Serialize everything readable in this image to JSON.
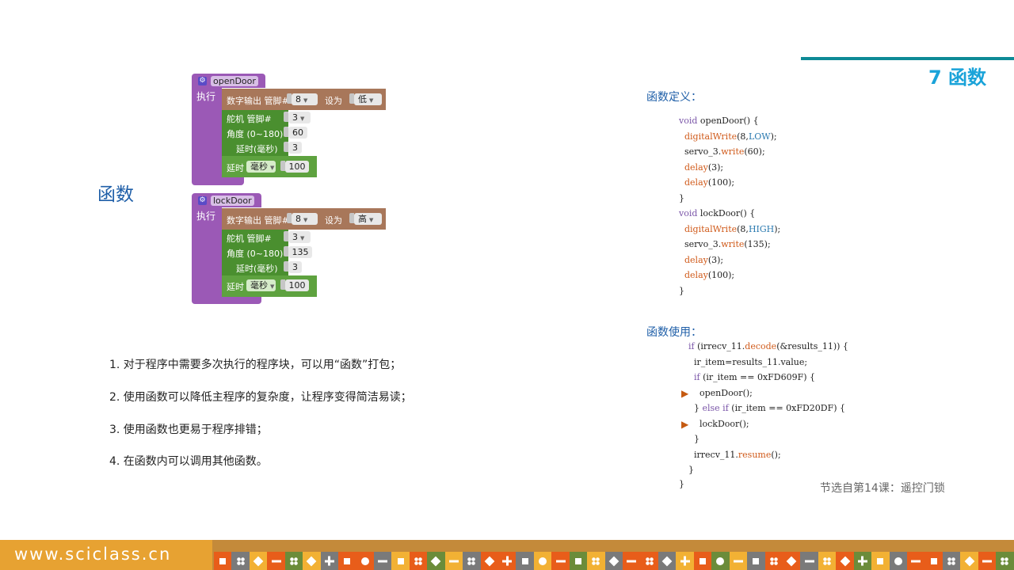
{
  "header": {
    "chapter_title": "7 函数"
  },
  "side_heading": "函数",
  "blocks": [
    {
      "name": "openDoor",
      "exec_label": "执行",
      "digital_out_label": "数字输出 管脚#",
      "pin_value": "8",
      "set_label": "设为",
      "level_value": "低",
      "servo_label": "舵机 管脚#",
      "servo_pin": "3",
      "angle_label": "角度 (0~180)",
      "angle_value": "60",
      "servo_delay_label": "延时(毫秒)",
      "servo_delay_value": "3",
      "delay_label": "延时",
      "delay_unit": "毫秒",
      "delay_value": "100"
    },
    {
      "name": "lockDoor",
      "exec_label": "执行",
      "digital_out_label": "数字输出 管脚#",
      "pin_value": "8",
      "set_label": "设为",
      "level_value": "高",
      "servo_label": "舵机 管脚#",
      "servo_pin": "3",
      "angle_label": "角度 (0~180)",
      "angle_value": "135",
      "servo_delay_label": "延时(毫秒)",
      "servo_delay_value": "3",
      "delay_label": "延时",
      "delay_unit": "毫秒",
      "delay_value": "100"
    }
  ],
  "notes": [
    "1. 对于程序中需要多次执行的程序块，可以用“函数”打包；",
    "2. 使用函数可以降低主程序的复杂度，让程序变得简洁易读；",
    "3. 使用函数也更易于程序排错；",
    "4. 在函数内可以调用其他函数。"
  ],
  "definition": {
    "label": "函数定义：",
    "lines": [
      {
        "segments": [
          [
            "kw",
            "void"
          ],
          [
            "",
            " openDoor() {"
          ]
        ]
      },
      {
        "segments": [
          [
            "fn",
            "  digitalWrite"
          ],
          [
            "",
            "(8,"
          ],
          [
            "cn",
            "LOW"
          ],
          [
            "",
            ");"
          ]
        ]
      },
      {
        "segments": [
          [
            "",
            "  servo_3."
          ],
          [
            "fn",
            "write"
          ],
          [
            "",
            "(60);"
          ]
        ]
      },
      {
        "segments": [
          [
            "fn",
            "  delay"
          ],
          [
            "",
            "(3);"
          ]
        ]
      },
      {
        "segments": [
          [
            "fn",
            "  delay"
          ],
          [
            "",
            "(100);"
          ]
        ]
      },
      {
        "segments": [
          [
            "",
            "}"
          ]
        ]
      },
      {
        "segments": [
          [
            "kw",
            "void"
          ],
          [
            "",
            " lockDoor() {"
          ]
        ]
      },
      {
        "segments": [
          [
            "fn",
            "  digitalWrite"
          ],
          [
            "",
            "(8,"
          ],
          [
            "cn",
            "HIGH"
          ],
          [
            "",
            ");"
          ]
        ]
      },
      {
        "segments": [
          [
            "",
            "  servo_3."
          ],
          [
            "fn",
            "write"
          ],
          [
            "",
            "(135);"
          ]
        ]
      },
      {
        "segments": [
          [
            "fn",
            "  delay"
          ],
          [
            "",
            "(3);"
          ]
        ]
      },
      {
        "segments": [
          [
            "fn",
            "  delay"
          ],
          [
            "",
            "(100);"
          ]
        ]
      },
      {
        "segments": [
          [
            "",
            "}"
          ]
        ]
      }
    ]
  },
  "usage": {
    "label": "函数使用：",
    "lines": [
      {
        "segments": [
          [
            "kw",
            "if"
          ],
          [
            "",
            " (irrecv_11."
          ],
          [
            "fn",
            "decode"
          ],
          [
            "",
            "(&results_11)) {"
          ]
        ]
      },
      {
        "segments": [
          [
            "",
            "  ir_item=results_11.value;"
          ]
        ]
      },
      {
        "segments": [
          [
            "kw",
            "  if"
          ],
          [
            "",
            " (ir_item == 0xFD609F) {"
          ]
        ]
      },
      {
        "segments": [
          [
            "",
            "    openDoor();"
          ]
        ],
        "marker": "▶"
      },
      {
        "segments": [
          [
            "",
            "  } "
          ],
          [
            "kw",
            "else if"
          ],
          [
            "",
            " (ir_item == 0xFD20DF) {"
          ]
        ]
      },
      {
        "segments": [
          [
            "",
            "    lockDoor();"
          ]
        ],
        "marker": "▶"
      },
      {
        "segments": [
          [
            "",
            "  }"
          ]
        ]
      },
      {
        "segments": [
          [
            "",
            "  irrecv_11."
          ],
          [
            "fn",
            "resume"
          ],
          [
            "",
            "();"
          ]
        ]
      },
      {
        "segments": [
          [
            "",
            "}"
          ]
        ]
      }
    ],
    "closing": "}"
  },
  "source_caption": "节选自第14课：遥控门锁",
  "footer": {
    "url": "www.sciclass.cn",
    "tile_colors": [
      "#e85d1a",
      "#7a7a7a",
      "#f2b134",
      "#e85d1a",
      "#6b8c3a",
      "#f2b134",
      "#7a7a7a",
      "#e85d1a"
    ],
    "tile_icons": [
      "sq",
      "dots4",
      "dia",
      "bar",
      "dots4",
      "dia",
      "plus",
      "sq",
      "dot",
      "bar"
    ]
  }
}
